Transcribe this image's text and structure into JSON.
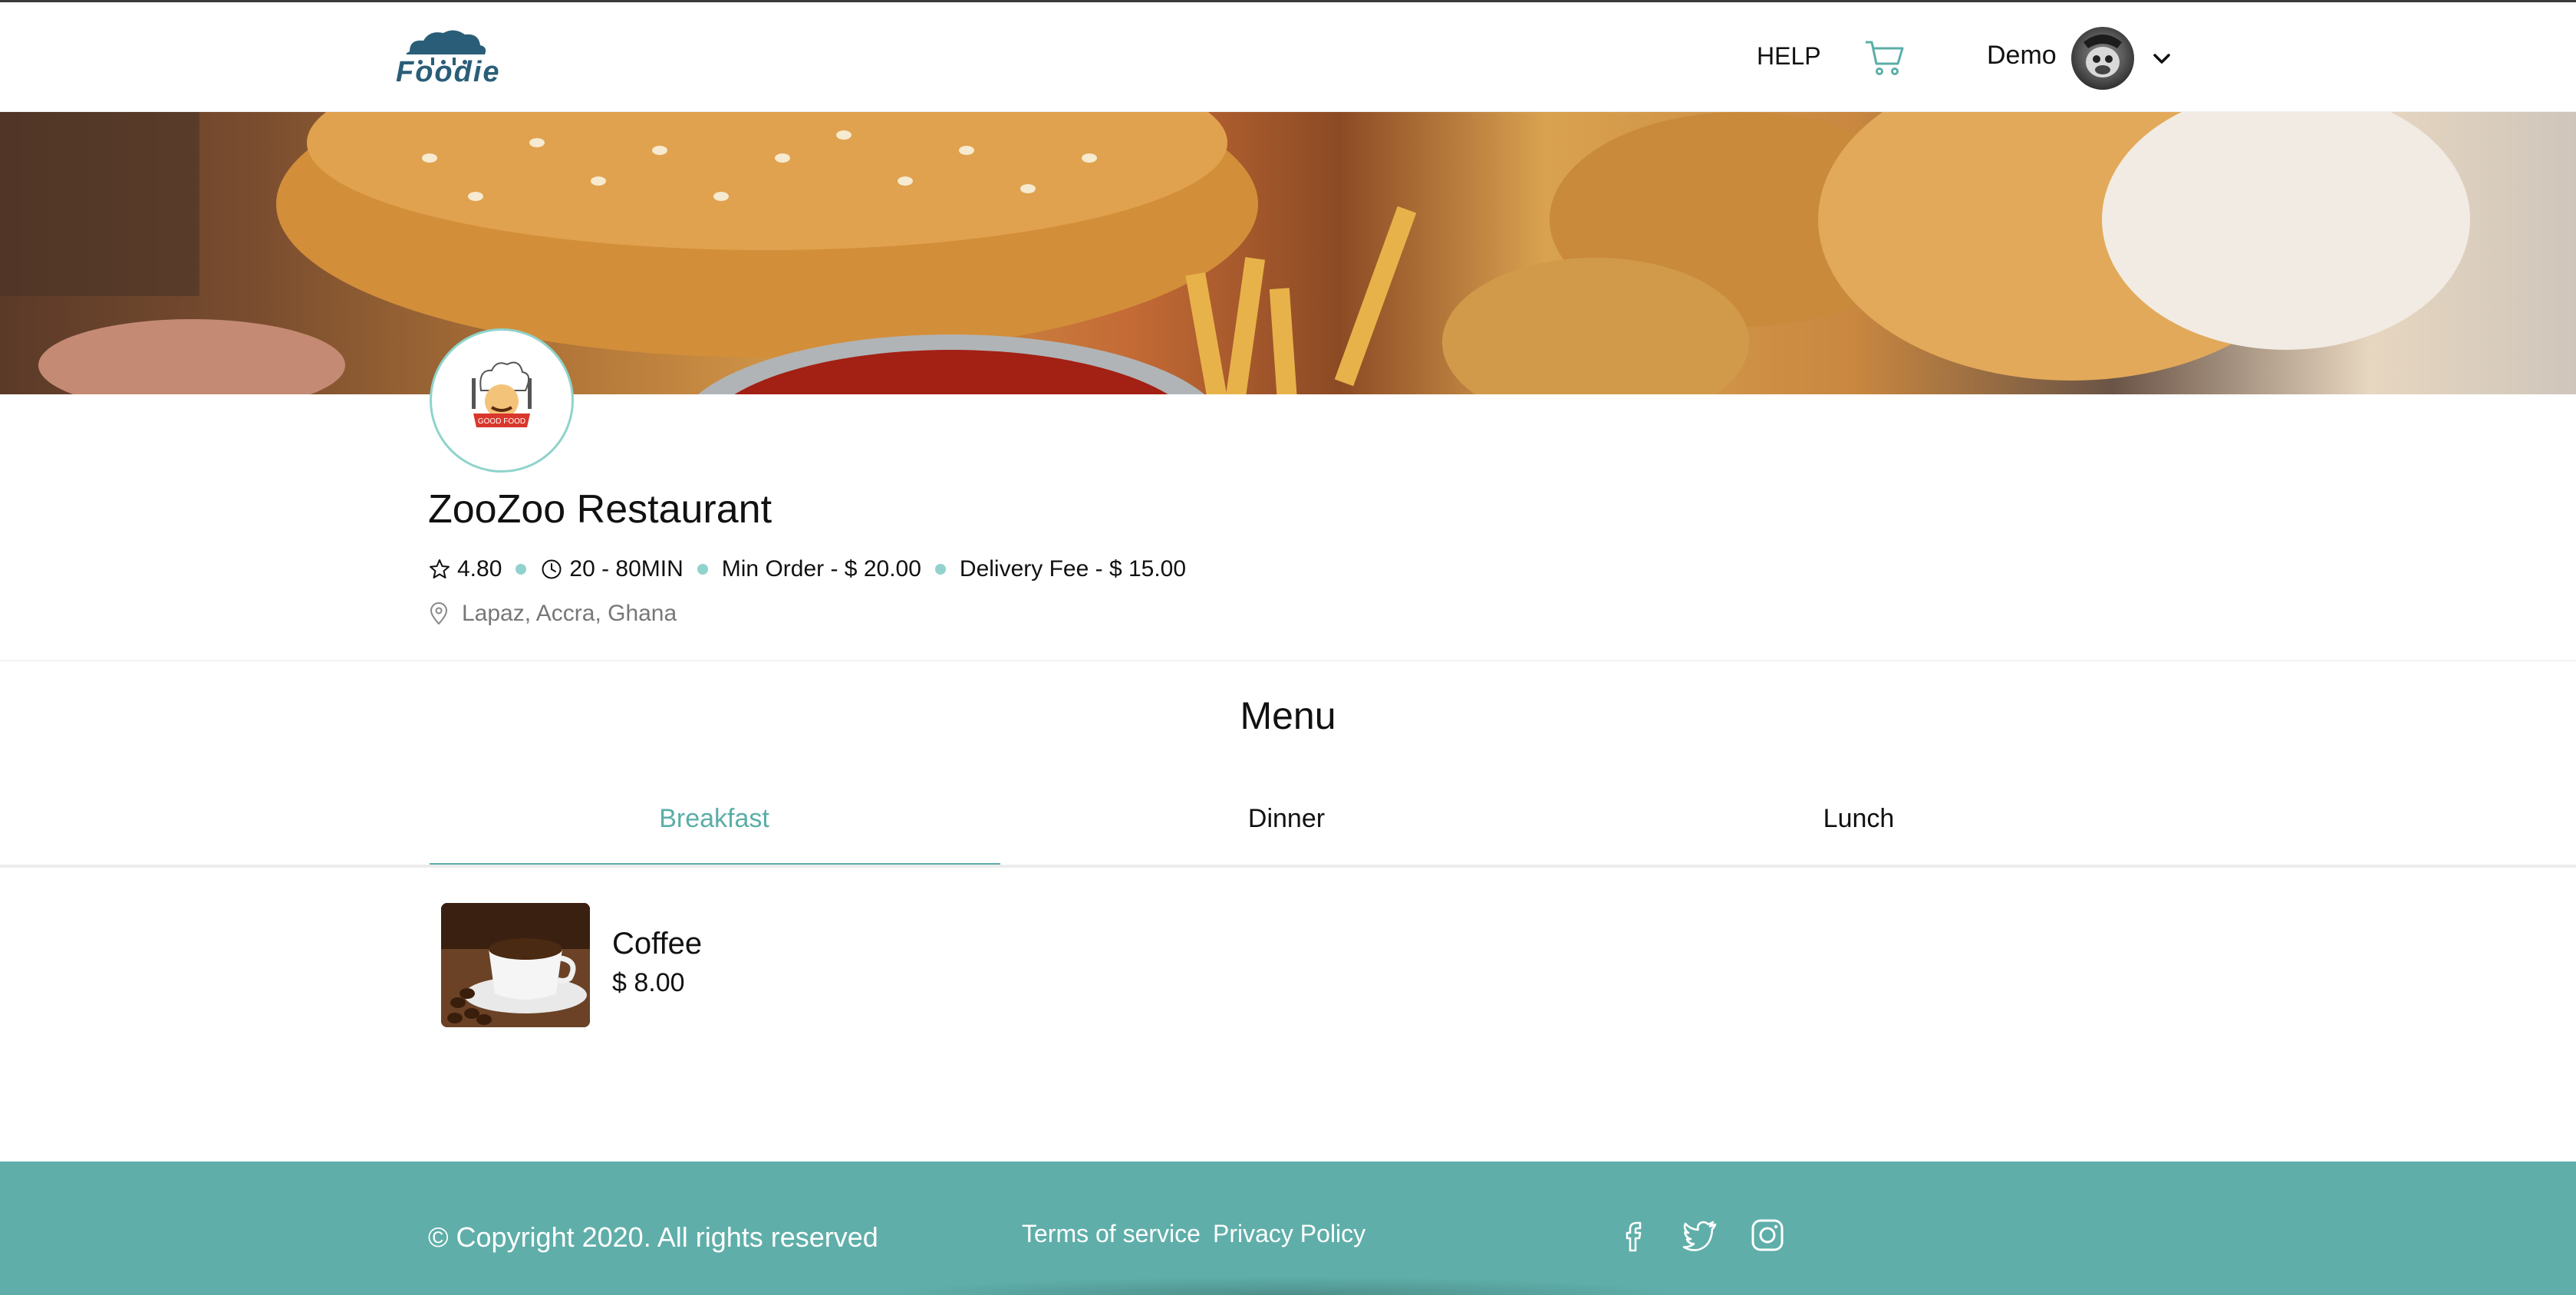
{
  "header": {
    "logo_text": "Foodie",
    "help_label": "HELP",
    "cart_icon": "cart-icon",
    "user_name": "Demo",
    "chevron_icon": "chevron-down-icon"
  },
  "restaurant": {
    "name": "ZooZoo Restaurant",
    "logo_text": "GOOD FOOD",
    "rating": "4.80",
    "delivery_time": "20 - 80MIN",
    "min_order": "Min Order - $ 20.00",
    "delivery_fee": "Delivery Fee - $ 15.00",
    "location": "Lapaz, Accra, Ghana"
  },
  "menu": {
    "title": "Menu",
    "tabs": [
      {
        "label": "Breakfast",
        "active": true
      },
      {
        "label": "Dinner",
        "active": false
      },
      {
        "label": "Lunch",
        "active": false
      }
    ],
    "items": [
      {
        "name": "Coffee",
        "price": "$ 8.00"
      }
    ]
  },
  "footer": {
    "copyright": "© Copyright 2020. All rights reserved",
    "terms": "Terms of service",
    "privacy": "Privacy Policy",
    "social": [
      "facebook-icon",
      "twitter-icon",
      "instagram-icon"
    ]
  },
  "colors": {
    "accent": "#5faea9",
    "accent_light": "#8fd3cc",
    "logo_blue": "#2a5e78"
  }
}
